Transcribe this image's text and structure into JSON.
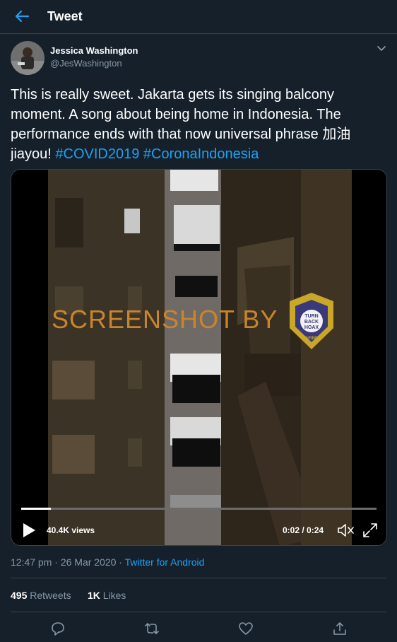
{
  "header": {
    "title": "Tweet"
  },
  "tweet": {
    "author_name": "Jessica Washington",
    "author_handle": "@JesWashington",
    "text_plain": "This is really sweet. Jakarta gets its singing balcony moment. A song about being home in Indonesia. The performance ends with that now universal phrase 加油 jiayou! ",
    "hashtag_1": "#COVID2019",
    "hashtag_2": "#CoronaIndonesia",
    "timestamp": "12:47 pm · 26 Mar 2020 · ",
    "source": "Twitter for Android",
    "retweets_count": "495",
    "retweets_label": "Retweets",
    "likes_count": "1K",
    "likes_label": "Likes"
  },
  "video": {
    "views": "40.4K views",
    "time": "0:02 / 0:24",
    "progress": 0.083,
    "watermark_text": "SCREENSHOT BY",
    "badge": {
      "line1": "TURN",
      "line2": "BACK",
      "line3": "HOAX",
      "brand": "MAFINDO"
    }
  },
  "colors": {
    "background": "#15202b",
    "accent": "#1da1f2",
    "muted": "#8899a6",
    "divider": "#38444d"
  },
  "icons": [
    "back-arrow-icon",
    "chevron-down-icon",
    "play-icon",
    "mute-icon",
    "fullscreen-icon",
    "reply-icon",
    "retweet-icon",
    "like-icon",
    "share-icon"
  ]
}
